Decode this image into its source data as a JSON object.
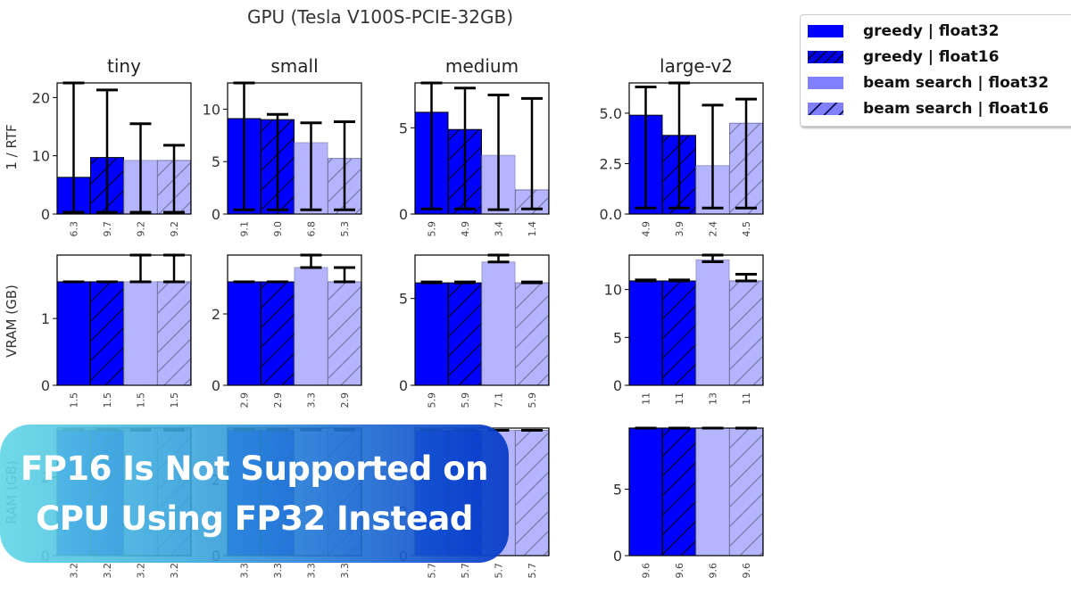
{
  "chart_data": {
    "type": "bar",
    "title": "GPU (Tesla V100S-PCIE-32GB)",
    "columns": [
      "tiny",
      "small",
      "medium",
      "large-v2"
    ],
    "legend": {
      "placement": "top-right",
      "entries": [
        {
          "label": "greedy | float32",
          "color": "#0000ff",
          "hatch": false
        },
        {
          "label": "greedy | float16",
          "color": "#0000ff",
          "hatch": true
        },
        {
          "label": "beam search | float32",
          "color": "#b4b4ff",
          "hatch": false
        },
        {
          "label": "beam search | float16",
          "color": "#b4b4ff",
          "hatch": true
        }
      ]
    },
    "rows": [
      {
        "ylabel": "1 / RTF",
        "panels": [
          {
            "model": "tiny",
            "ylim": [
              0,
              22.5
            ],
            "yticks": [
              0,
              10,
              20
            ],
            "ytick_labels": [
              "0",
              "10",
              "20"
            ],
            "values": [
              6.3,
              9.7,
              9.2,
              9.2
            ],
            "value_labels": [
              "6.3",
              "9.7",
              "9.2",
              "9.2"
            ],
            "err_low": [
              0.3,
              0.3,
              0.3,
              0.3
            ],
            "err_high": [
              22.5,
              21.3,
              15.5,
              11.8
            ]
          },
          {
            "model": "small",
            "ylim": [
              0,
              12.5
            ],
            "yticks": [
              0,
              5,
              10
            ],
            "ytick_labels": [
              "0",
              "5",
              "10"
            ],
            "values": [
              9.1,
              9.0,
              6.8,
              5.3
            ],
            "value_labels": [
              "9.1",
              "9.0",
              "6.8",
              "5.3"
            ],
            "err_low": [
              0.4,
              0.4,
              0.4,
              0.4
            ],
            "err_high": [
              12.5,
              9.5,
              8.7,
              8.8
            ]
          },
          {
            "model": "medium",
            "ylim": [
              0,
              7.6
            ],
            "yticks": [
              0,
              5
            ],
            "ytick_labels": [
              "0",
              "5"
            ],
            "values": [
              5.9,
              4.9,
              3.4,
              1.4
            ],
            "value_labels": [
              "5.9",
              "4.9",
              "3.4",
              "1.4"
            ],
            "err_low": [
              0.3,
              0.3,
              0.25,
              0.3
            ],
            "err_high": [
              7.6,
              7.3,
              6.9,
              6.7
            ]
          },
          {
            "model": "large-v2",
            "ylim": [
              0,
              6.5
            ],
            "yticks": [
              0,
              2.5,
              5.0
            ],
            "ytick_labels": [
              "0.0",
              "2.5",
              "5.0"
            ],
            "values": [
              4.9,
              3.9,
              2.4,
              4.5
            ],
            "value_labels": [
              "4.9",
              "3.9",
              "2.4",
              "4.5"
            ],
            "err_low": [
              0.3,
              0.3,
              0.3,
              0.3
            ],
            "err_high": [
              6.3,
              6.5,
              5.4,
              5.7
            ]
          }
        ]
      },
      {
        "ylabel": "VRAM (GB)",
        "panels": [
          {
            "model": "tiny",
            "ylim": [
              0,
              1.95
            ],
            "yticks": [
              0,
              1
            ],
            "ytick_labels": [
              "0",
              "1"
            ],
            "values": [
              1.55,
              1.55,
              1.55,
              1.55
            ],
            "value_labels": [
              "1.5",
              "1.5",
              "1.5",
              "1.5"
            ],
            "err_low": [
              1.55,
              1.55,
              1.55,
              1.55
            ],
            "err_high": [
              1.55,
              1.55,
              1.95,
              1.95
            ]
          },
          {
            "model": "small",
            "ylim": [
              0,
              3.65
            ],
            "yticks": [
              0,
              2
            ],
            "ytick_labels": [
              "0",
              "2"
            ],
            "values": [
              2.9,
              2.9,
              3.3,
              2.9
            ],
            "value_labels": [
              "2.9",
              "2.9",
              "3.3",
              "2.9"
            ],
            "err_low": [
              2.9,
              2.9,
              3.3,
              2.9
            ],
            "err_high": [
              2.9,
              2.9,
              3.65,
              3.3
            ]
          },
          {
            "model": "medium",
            "ylim": [
              0,
              7.5
            ],
            "yticks": [
              0,
              5
            ],
            "ytick_labels": [
              "0",
              "5"
            ],
            "values": [
              5.9,
              5.9,
              7.1,
              5.9
            ],
            "value_labels": [
              "5.9",
              "5.9",
              "7.1",
              "5.9"
            ],
            "err_low": [
              5.9,
              5.9,
              7.1,
              5.9
            ],
            "err_high": [
              5.95,
              5.95,
              7.5,
              5.95
            ]
          },
          {
            "model": "large-v2",
            "ylim": [
              0,
              13.6
            ],
            "yticks": [
              0,
              5,
              10
            ],
            "ytick_labels": [
              "0",
              "5",
              "10"
            ],
            "values": [
              10.9,
              10.9,
              13.1,
              10.9
            ],
            "value_labels": [
              "11",
              "11",
              "13",
              "11"
            ],
            "err_low": [
              10.9,
              10.9,
              12.9,
              10.9
            ],
            "err_high": [
              11.0,
              11.0,
              13.6,
              11.6
            ]
          }
        ]
      },
      {
        "ylabel": "RAM (GB)",
        "panels": [
          {
            "model": "tiny",
            "ylim": [
              0,
              3.25
            ],
            "yticks": [
              0,
              2
            ],
            "ytick_labels": [
              "0",
              "2"
            ],
            "values": [
              3.2,
              3.2,
              3.2,
              3.2
            ],
            "value_labels": [
              "3.2",
              "3.2",
              "3.2",
              "3.2"
            ],
            "err_low": [
              3.2,
              3.2,
              3.2,
              3.2
            ],
            "err_high": [
              3.2,
              3.2,
              3.2,
              3.2
            ]
          },
          {
            "model": "small",
            "ylim": [
              0,
              3.35
            ],
            "yticks": [
              0,
              2
            ],
            "ytick_labels": [
              "0",
              "2"
            ],
            "values": [
              3.3,
              3.3,
              3.3,
              3.3
            ],
            "value_labels": [
              "3.3",
              "3.3",
              "3.3",
              "3.3"
            ],
            "err_low": [
              3.3,
              3.3,
              3.3,
              3.3
            ],
            "err_high": [
              3.3,
              3.3,
              3.3,
              3.3
            ]
          },
          {
            "model": "medium",
            "ylim": [
              0,
              5.8
            ],
            "yticks": [
              0,
              2
            ],
            "ytick_labels": [
              "0",
              "2"
            ],
            "values": [
              5.7,
              5.7,
              5.7,
              5.7
            ],
            "value_labels": [
              "5.7",
              "5.7",
              "5.7",
              "5.7"
            ],
            "err_low": [
              5.7,
              5.7,
              5.7,
              5.7
            ],
            "err_high": [
              5.7,
              5.7,
              5.7,
              5.7
            ]
          },
          {
            "model": "large-v2",
            "ylim": [
              0,
              9.6
            ],
            "yticks": [
              0,
              5
            ],
            "ytick_labels": [
              "0",
              "5"
            ],
            "values": [
              9.6,
              9.6,
              9.6,
              9.6
            ],
            "value_labels": [
              "9.6",
              "9.6",
              "9.6",
              "9.6"
            ],
            "err_low": [
              9.6,
              9.6,
              9.6,
              9.6
            ],
            "err_high": [
              9.6,
              9.6,
              9.6,
              9.6
            ]
          }
        ]
      }
    ]
  },
  "banner": {
    "line1": "FP16 Is Not Supported on",
    "line2": "CPU Using FP32 Instead"
  }
}
